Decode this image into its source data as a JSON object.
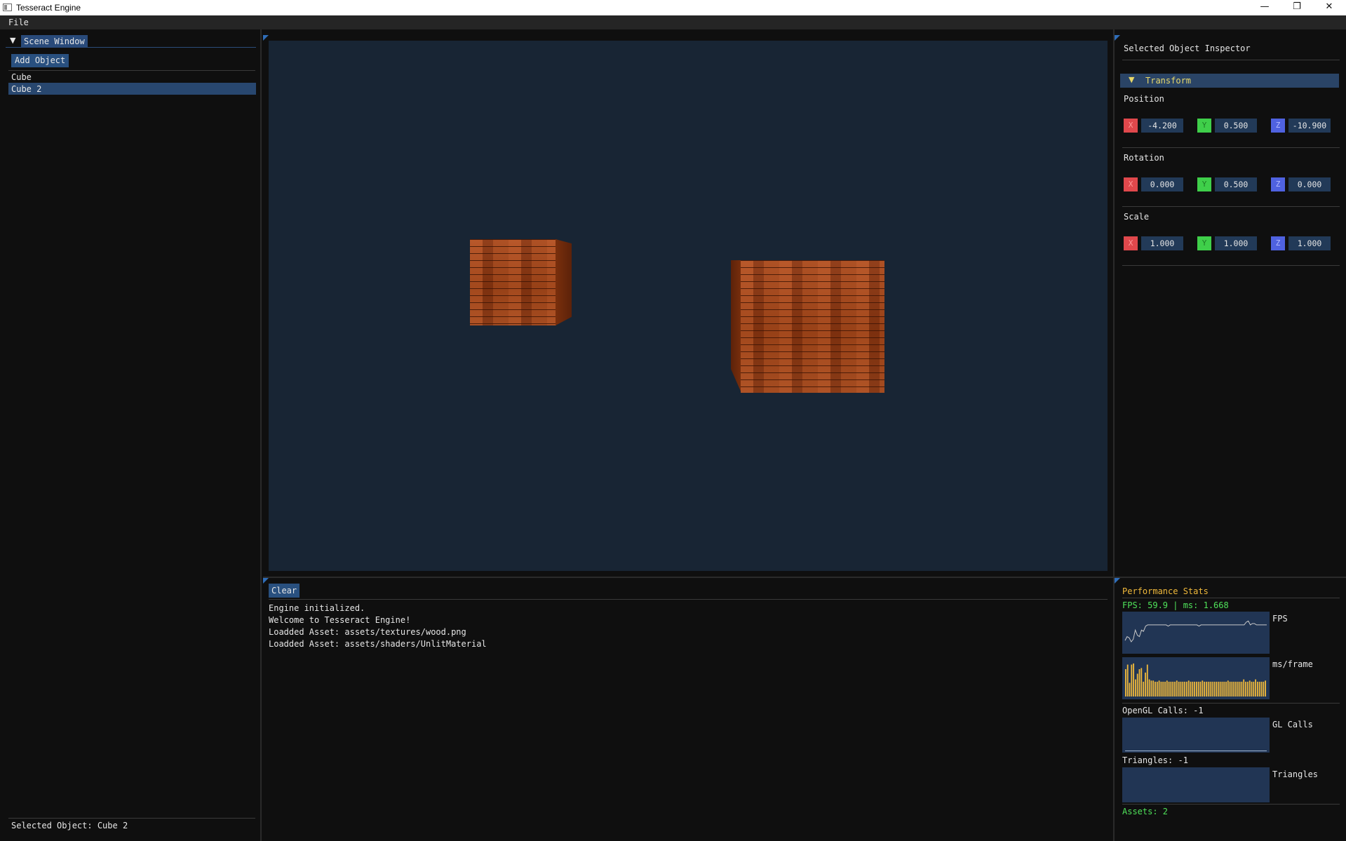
{
  "window": {
    "title": "Tesseract Engine",
    "minimize_glyph": "—",
    "maximize_glyph": "❐",
    "close_glyph": "✕"
  },
  "menu": {
    "file": "File"
  },
  "scene": {
    "collapse_glyph": "▼",
    "tab_label": "Scene Window",
    "add_object_label": "Add Object",
    "items": [
      {
        "label": "Cube",
        "selected": false
      },
      {
        "label": "Cube 2",
        "selected": true
      }
    ],
    "selected_status": "Selected Object: Cube 2"
  },
  "console": {
    "clear_label": "Clear",
    "lines": [
      "Engine initialized.",
      "Welcome to Tesseract Engine!",
      "Loadded Asset: assets/textures/wood.png",
      "Loadded Asset: assets/shaders/UnlitMaterial"
    ]
  },
  "inspector": {
    "title": "Selected Object Inspector",
    "transform_arrow": "▼",
    "transform_label": "Transform",
    "axis_labels": {
      "x": "X",
      "y": "Y",
      "z": "Z"
    },
    "position": {
      "label": "Position",
      "x": "-4.200",
      "y": "0.500",
      "z": "-10.900"
    },
    "rotation": {
      "label": "Rotation",
      "x": "0.000",
      "y": "0.500",
      "z": "0.000"
    },
    "scale": {
      "label": "Scale",
      "x": "1.000",
      "y": "1.000",
      "z": "1.000"
    }
  },
  "perf": {
    "title": "Performance Stats",
    "fps_line": "FPS: 59.9 | ms: 1.668",
    "fps_plot_label": "FPS",
    "ms_plot_label": "ms/frame",
    "gl_calls_text": "OpenGL Calls: -1",
    "gl_plot_label": "GL Calls",
    "triangles_text": "Triangles: -1",
    "tri_plot_label": "Triangles",
    "assets_text": "Assets: 2",
    "fps_history": [
      48,
      51,
      50,
      47,
      49,
      56,
      52,
      51,
      56,
      55,
      59,
      60,
      60,
      60,
      60,
      60,
      60,
      60,
      60,
      60,
      60,
      59,
      60,
      60,
      60,
      60,
      60,
      60,
      60,
      60,
      60,
      60,
      60,
      60,
      60,
      60,
      59,
      60,
      60,
      60,
      60,
      60,
      60,
      60,
      60,
      60,
      60,
      60,
      60,
      60,
      60,
      60,
      60,
      60,
      60,
      60,
      60,
      60,
      60,
      62,
      63,
      60,
      61,
      61,
      60,
      60,
      60,
      60,
      60,
      60
    ],
    "ms_history": [
      2.4,
      2.8,
      1.2,
      2.8,
      2.9,
      1.5,
      2.0,
      2.4,
      2.5,
      1.3,
      2.1,
      2.8,
      1.5,
      1.4,
      1.4,
      1.3,
      1.3,
      1.4,
      1.3,
      1.3,
      1.3,
      1.4,
      1.3,
      1.3,
      1.3,
      1.3,
      1.4,
      1.3,
      1.3,
      1.3,
      1.3,
      1.3,
      1.4,
      1.3,
      1.3,
      1.3,
      1.3,
      1.3,
      1.3,
      1.4,
      1.3,
      1.3,
      1.3,
      1.3,
      1.3,
      1.3,
      1.3,
      1.3,
      1.3,
      1.3,
      1.3,
      1.3,
      1.4,
      1.3,
      1.3,
      1.3,
      1.3,
      1.3,
      1.3,
      1.3,
      1.5,
      1.3,
      1.3,
      1.4,
      1.3,
      1.3,
      1.5,
      1.3,
      1.3,
      1.3,
      1.3,
      1.4
    ],
    "colors": {
      "fps_line": "#c8c8c8",
      "ms_bars": "#f0b93b",
      "accent_green": "#4fe35a",
      "title_orange": "#f0b93b"
    }
  }
}
